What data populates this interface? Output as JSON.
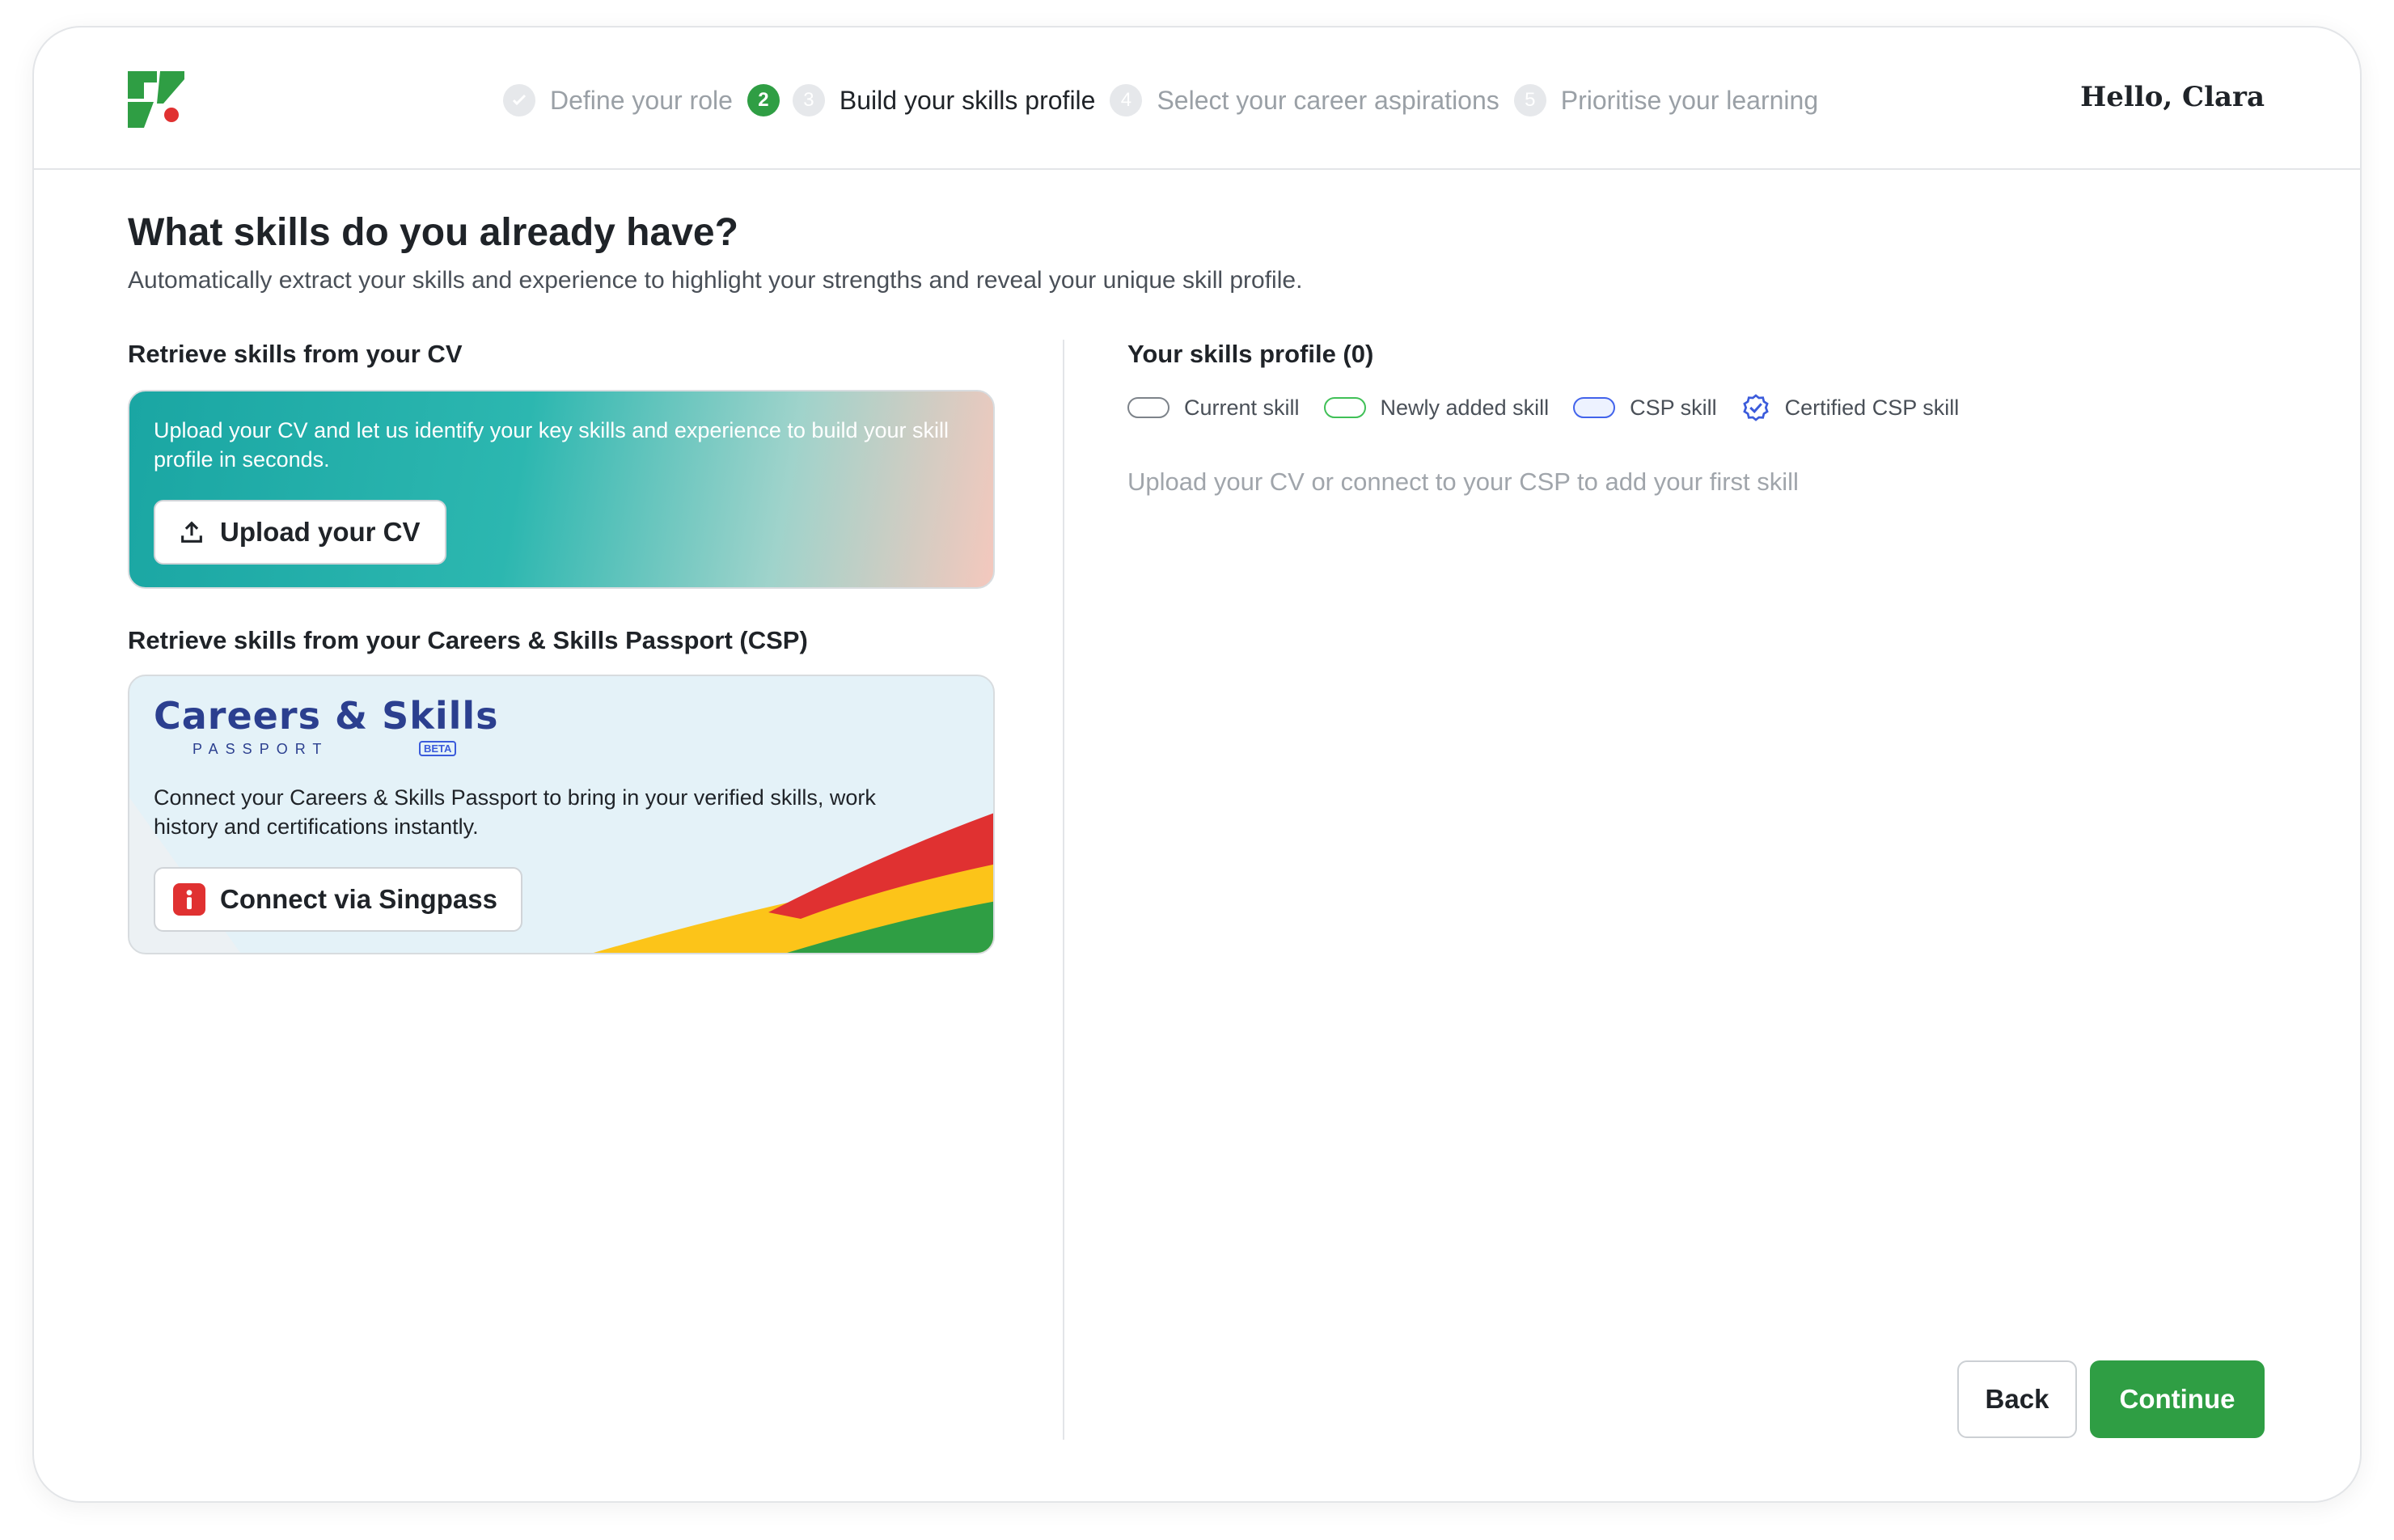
{
  "header": {
    "steps": [
      {
        "number": "✓",
        "label": "Define your role",
        "state": "done"
      },
      {
        "number": "2",
        "label": "",
        "state": "current"
      },
      {
        "number": "3",
        "label": "Build your skills profile",
        "state": "active"
      },
      {
        "number": "4",
        "label": "Select your career aspirations",
        "state": "upcoming"
      },
      {
        "number": "5",
        "label": "Prioritise your learning",
        "state": "upcoming"
      }
    ],
    "greeting": "Hello, Clara"
  },
  "page": {
    "title": "What skills do you already have?",
    "subtitle": "Automatically extract your skills and experience to highlight your strengths and reveal your unique skill profile."
  },
  "cv_section": {
    "label": "Retrieve skills from your CV",
    "description": "Upload your CV and let us identify your key skills and experience to build your skill profile in seconds.",
    "button": "Upload your CV"
  },
  "csp_section": {
    "label": "Retrieve skills from your Careers & Skills Passport (CSP)",
    "logo_title": "Careers & Skills",
    "logo_subtitle": "PASSPORT",
    "logo_badge": "BETA",
    "description": "Connect your Careers & Skills Passport to bring in your verified skills, work history and certifications instantly.",
    "button": "Connect via Singpass"
  },
  "profile": {
    "title": "Your skills profile (0)",
    "legend": [
      {
        "label": "Current skill",
        "icon": "pill-outline-gray"
      },
      {
        "label": "Newly added skill",
        "icon": "pill-outline-green"
      },
      {
        "label": "CSP skill",
        "icon": "pill-outline-blue"
      },
      {
        "label": "Certified CSP skill",
        "icon": "verified-badge-icon"
      }
    ],
    "empty_message": "Upload your CV or connect to your CSP to add your first skill"
  },
  "footer": {
    "back": "Back",
    "continue": "Continue"
  },
  "colors": {
    "brand_green": "#2f9e44",
    "csp_blue": "#4263eb",
    "singpass_red": "#e03131"
  }
}
